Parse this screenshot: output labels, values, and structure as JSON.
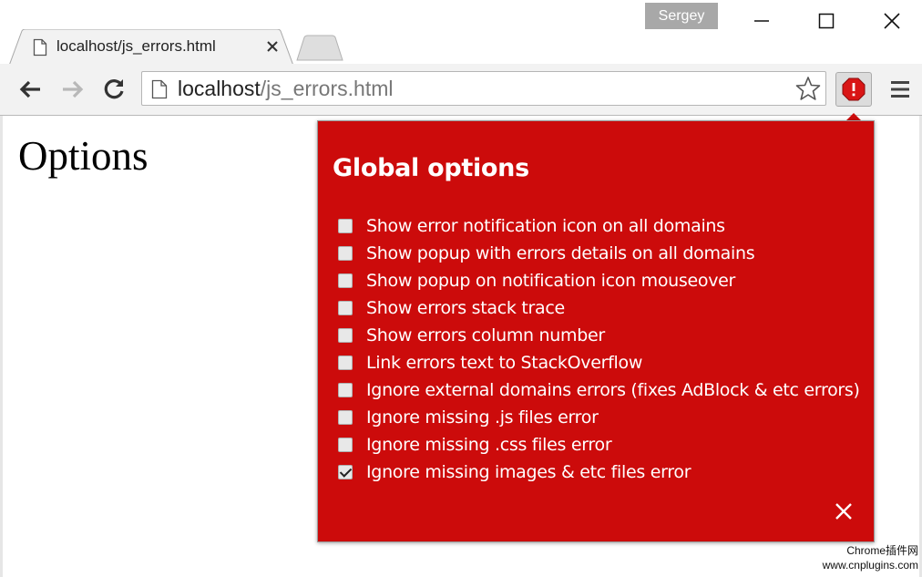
{
  "window": {
    "user_name": "Sergey",
    "minimize_icon": "minimize-icon",
    "maximize_icon": "maximize-icon",
    "close_icon": "close-icon"
  },
  "tabs": [
    {
      "title": "localhost/js_errors.html",
      "icon": "page-icon",
      "close_icon": "close-icon",
      "active": true
    }
  ],
  "toolbar": {
    "back_icon": "arrow-left-icon",
    "forward_icon": "arrow-right-icon",
    "reload_icon": "reload-icon",
    "url_host": "localhost",
    "url_path": "/js_errors.html",
    "bookmark_icon": "star-icon",
    "extension_icon": "error-notifier-icon",
    "menu_icon": "hamburger-menu-icon"
  },
  "page": {
    "heading": "Options"
  },
  "popup": {
    "title": "Global options",
    "background_color": "#cc0b0b",
    "options": [
      {
        "label": "Show error notification icon on all domains",
        "checked": false
      },
      {
        "label": "Show popup with errors details on all domains",
        "checked": false
      },
      {
        "label": "Show popup on notification icon mouseover",
        "checked": false
      },
      {
        "label": "Show errors stack trace",
        "checked": false
      },
      {
        "label": "Show errors column number",
        "checked": false
      },
      {
        "label": "Link errors text to StackOverflow",
        "checked": false
      },
      {
        "label": "Ignore external domains errors (fixes AdBlock & etc errors)",
        "checked": false
      },
      {
        "label": "Ignore missing .js files error",
        "checked": false
      },
      {
        "label": "Ignore missing .css files error",
        "checked": false
      },
      {
        "label": "Ignore missing images & etc files error",
        "checked": true
      }
    ],
    "close_icon": "close-icon"
  },
  "watermark": {
    "line1": "Chrome插件网",
    "line2": "www.cnplugins.com"
  }
}
